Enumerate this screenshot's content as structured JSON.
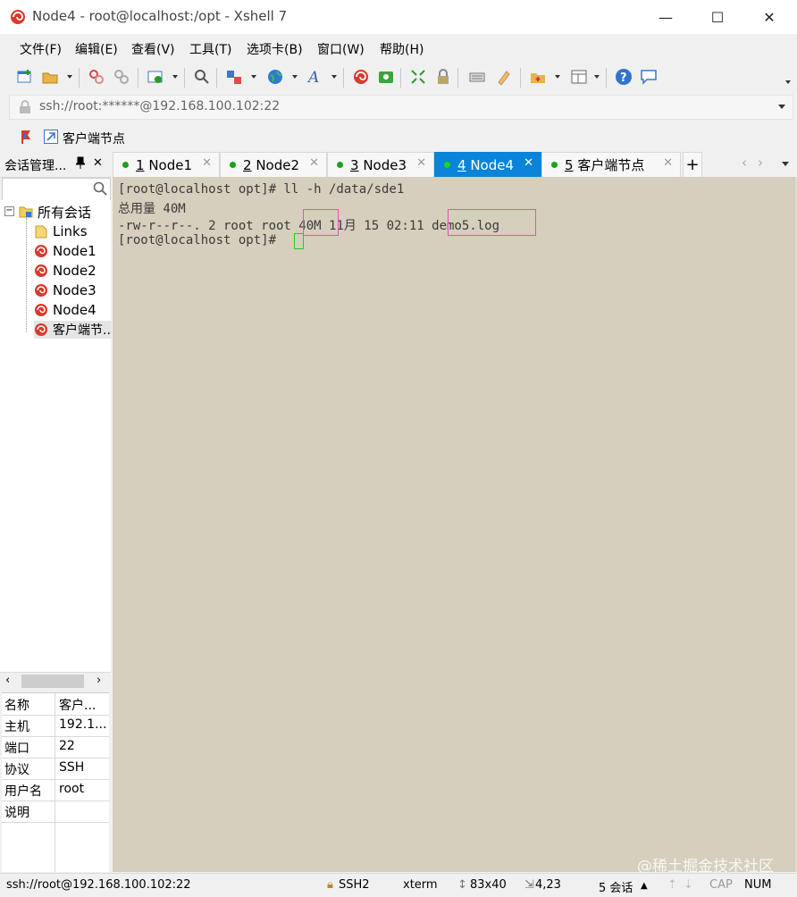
{
  "window": {
    "title": "Node4 - root@localhost:/opt - Xshell 7",
    "minimize": "—",
    "maximize": "☐",
    "close": "✕"
  },
  "menu": [
    "文件(F)",
    "编辑(E)",
    "查看(V)",
    "工具(T)",
    "选项卡(B)",
    "窗口(W)",
    "帮助(H)"
  ],
  "address": {
    "value": "ssh://root:******@192.168.100.102:22"
  },
  "quickbar": {
    "link_label": "客户端节点"
  },
  "session_manager": {
    "title": "会话管理...",
    "pin": "ᵖ",
    "close": "✕",
    "tree": {
      "root": "所有会话",
      "items": [
        "Links",
        "Node1",
        "Node2",
        "Node3",
        "Node4",
        "客户端节..."
      ]
    },
    "properties": [
      {
        "key": "名称",
        "value": "客户..."
      },
      {
        "key": "主机",
        "value": "192.1..."
      },
      {
        "key": "端口",
        "value": "22"
      },
      {
        "key": "协议",
        "value": "SSH"
      },
      {
        "key": "用户名",
        "value": "root"
      },
      {
        "key": "说明",
        "value": ""
      }
    ]
  },
  "tabs": [
    {
      "num": "1",
      "label": "Node1",
      "active": false
    },
    {
      "num": "2",
      "label": "Node2",
      "active": false
    },
    {
      "num": "3",
      "label": "Node3",
      "active": false
    },
    {
      "num": "4",
      "label": "Node4",
      "active": true
    },
    {
      "num": "5",
      "label": "客户端节点",
      "active": false
    }
  ],
  "add_tab": "+",
  "terminal": {
    "lines": [
      "[root@localhost opt]# ll -h /data/sde1",
      "总用量 40M",
      "-rw-r--r--. 2 root root 40M 11月 15 02:11 demo5.log",
      "[root@localhost opt]# "
    ]
  },
  "status": {
    "connection": "ssh://root@192.168.100.102:22",
    "protocol": "SSH2",
    "term": "xterm",
    "size": "83x40",
    "cursor": "4,23",
    "sessions": "5 会话",
    "cap": "CAP",
    "num": "NUM"
  },
  "watermark": "@稀土掘金技术社区",
  "colors": {
    "terminal_bg": "#d6cfbd",
    "active_tab": "#0a84d8",
    "highlight_box": "#e64fbd",
    "cursor": "#1fcf1f"
  }
}
